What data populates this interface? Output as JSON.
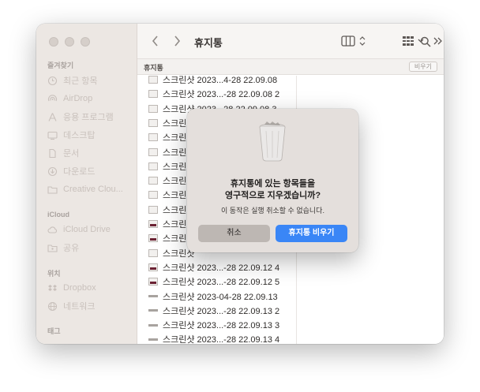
{
  "window": {
    "title": "휴지통",
    "path_label": "휴지통",
    "empty_button": "비우기"
  },
  "sidebar": {
    "favorites_header": "즐겨찾기",
    "favorites": [
      {
        "label": "최근 항목",
        "icon": "clock-icon"
      },
      {
        "label": "AirDrop",
        "icon": "airdrop-icon"
      },
      {
        "label": "응용 프로그램",
        "icon": "applications-icon"
      },
      {
        "label": "데스크탑",
        "icon": "desktop-icon"
      },
      {
        "label": "문서",
        "icon": "document-icon"
      },
      {
        "label": "다운로드",
        "icon": "download-icon"
      },
      {
        "label": "Creative Clou...",
        "icon": "folder-icon"
      }
    ],
    "icloud_header": "iCloud",
    "icloud": [
      {
        "label": "iCloud Drive",
        "icon": "cloud-icon"
      },
      {
        "label": "공유",
        "icon": "shared-folder-icon"
      }
    ],
    "locations_header": "위치",
    "locations": [
      {
        "label": "Dropbox",
        "icon": "dropbox-icon"
      },
      {
        "label": "네트워크",
        "icon": "network-icon"
      }
    ],
    "tags_header": "태그"
  },
  "files": [
    {
      "name": "스크린샷 2023...4-28 22.09.08",
      "thumb": "light"
    },
    {
      "name": "스크린샷 2023...-28 22.09.08 2",
      "thumb": "light"
    },
    {
      "name": "스크린샷 2023...28 22.09.08 3",
      "thumb": "light"
    },
    {
      "name": "스크린샷",
      "thumb": "light"
    },
    {
      "name": "스크린샷",
      "thumb": "light"
    },
    {
      "name": "스크린샷",
      "thumb": "light"
    },
    {
      "name": "스크린샷",
      "thumb": "light"
    },
    {
      "name": "스크린샷",
      "thumb": "light"
    },
    {
      "name": "스크린샷",
      "thumb": "light"
    },
    {
      "name": "스크린샷",
      "thumb": "light"
    },
    {
      "name": "스크린샷",
      "thumb": "dark"
    },
    {
      "name": "스크린샷",
      "thumb": "dark"
    },
    {
      "name": "스크린샷",
      "thumb": "light"
    },
    {
      "name": "스크린샷 2023...-28 22.09.12 4",
      "thumb": "dark"
    },
    {
      "name": "스크린샷 2023...-28 22.09.12 5",
      "thumb": "dark"
    },
    {
      "name": "스크린샷 2023-04-28 22.09.13",
      "thumb": "line"
    },
    {
      "name": "스크린샷 2023...-28 22.09.13 2",
      "thumb": "line"
    },
    {
      "name": "스크린샷 2023...-28 22.09.13 3",
      "thumb": "line"
    },
    {
      "name": "스크린샷 2023...-28 22.09.13 4",
      "thumb": "line"
    }
  ],
  "dialog": {
    "title_line1": "휴지통에 있는 항목들을",
    "title_line2": "영구적으로 지우겠습니까?",
    "message": "이 동작은 실행 취소할 수 없습니다.",
    "cancel_label": "취소",
    "confirm_label": "휴지통 비우기"
  },
  "colors": {
    "accent": "#3a86f6",
    "sidebar_bg": "#ece7e3",
    "dialog_bg": "#e4dfdc"
  }
}
